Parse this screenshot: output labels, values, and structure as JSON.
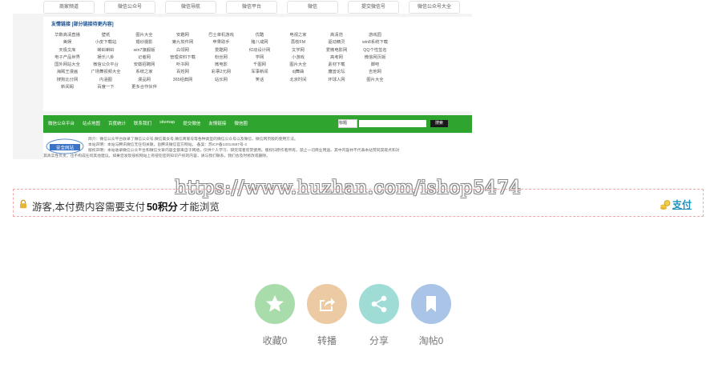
{
  "screenshot": {
    "top_row": [
      "商家频道",
      "微信公众号",
      "微信导航",
      "微信平台",
      "微信",
      "提交微信号",
      "微信公众号大全"
    ],
    "links_title": "友情链接 [部分链接待更内容]",
    "links": [
      [
        "华数高清直播",
        "壁纸",
        "图片大全",
        "安趣网",
        "巴士单机游戏",
        "优酷",
        "电视之家",
        "高清范",
        "游戏园"
      ],
      [
        "美娱",
        "小皮下载站",
        "婚纱摄影",
        "第九软件网",
        "苹果助手",
        "猪八戒网",
        "荔枝FM",
        "驱动精灵",
        "win8系统下载"
      ],
      [
        "天极文库",
        "蝌蚪蝌蚪",
        "win7旗舰版",
        "白领网",
        "爱酷网",
        "红动设计网",
        "文学网",
        "爱微电影网",
        "QQ个性签名"
      ],
      [
        "电子产品世界",
        "娱乐八卦",
        "记者网",
        "管理资料下载",
        "粉丝网",
        "学网",
        "小游戏",
        "高考网",
        "微信网页版"
      ],
      [
        "国外网站大全",
        "微信公众平台",
        "安徽招聘网",
        "听书网",
        "微电影",
        "千图网",
        "图片大全",
        "素材下载",
        "脚吧"
      ],
      [
        "海贼王漫画",
        "广场舞视频大全",
        "系统之家",
        "百姓网",
        "彩票2元网",
        "军事新闻",
        "dj舞曲",
        "魔兽论坛",
        "吉他网"
      ],
      [
        "搜狗比分网",
        "内涵图",
        "漫品网",
        "365经典网",
        "站长网",
        "笑话",
        "北京时间",
        "环球人网",
        "图片大全"
      ],
      [
        "新闻阁",
        "百度一下",
        "更多合作伙伴"
      ]
    ],
    "nav": [
      "微信公众平台",
      "站点地图",
      "百度统计",
      "联系我们",
      "sitemap",
      "提交微信",
      "友情链接",
      "微信圈"
    ],
    "search_select": "标题",
    "search_button": "搜索",
    "badge_text": "安全网站",
    "footer_lines": [
      "简介：微信公众平台收录了微信公众号,微信美女号,微信商家号等各种类型的微信公众号以及微信、微信网页版的使用方法。",
      "本站声明：本站与腾讯微信无任何关联，旨腾讯微信官方网站。 备案：苏ICP备13014587号-2",
      "版权声明：本站收录微信公众平台和微信文章内容全部来自于网络，仅供个人学习、研究或者欣赏使用。版权归原作者所有。禁止一切商业用途。其中内容并不代表本站赞同其观点和对",
      "其真实性负责，也不构成任何其他建议。如果您发现侵权网站上有侵犯您的知识产权的内容，请与我们联系，我们会及时修改或删除。"
    ]
  },
  "watermark": "https://www.huzhan.com/ishop5474",
  "notice": {
    "prefix": "游客,本付费内容需要支付",
    "points": "50积分",
    "suffix": "才能浏览",
    "pay_label": "支付"
  },
  "actions": [
    {
      "label": "收藏0",
      "icon": "star-icon",
      "color": "#a8dcaa"
    },
    {
      "label": "转播",
      "icon": "share-arrow-icon",
      "color": "#eccaa3"
    },
    {
      "label": "分享",
      "icon": "share-icon",
      "color": "#9fdcd6"
    },
    {
      "label": "淘帖0",
      "icon": "bookmark-icon",
      "color": "#a9c4e6"
    }
  ]
}
